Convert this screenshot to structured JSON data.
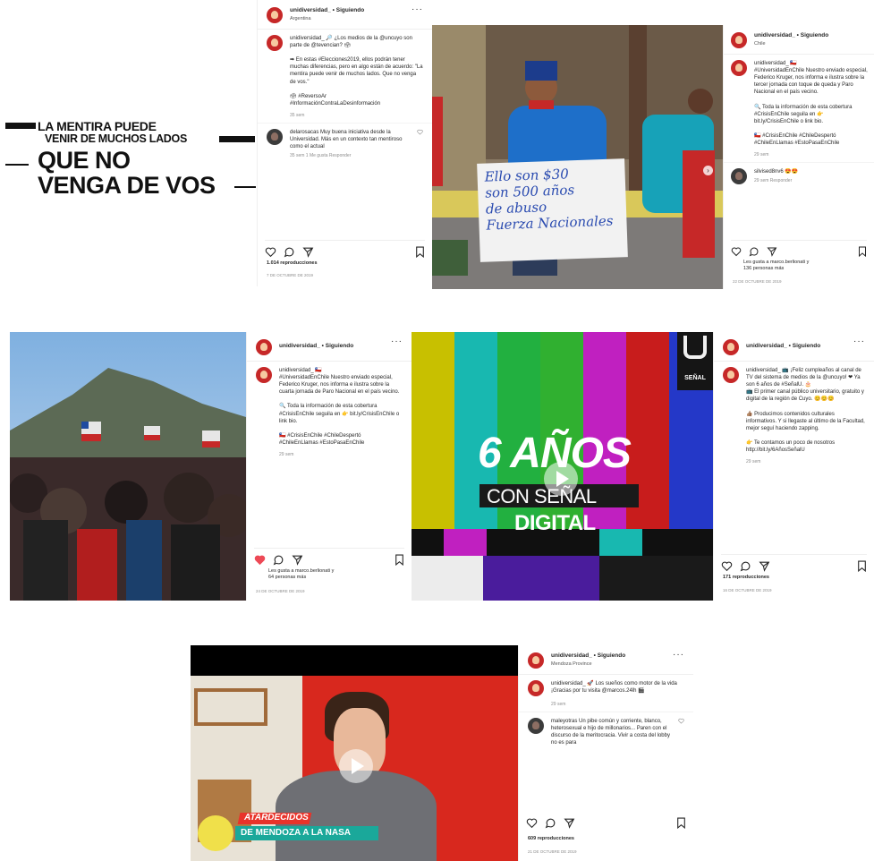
{
  "poster": {
    "line1": "LA MENTIRA PUEDE",
    "line2": "VENIR DE MUCHOS LADOS",
    "line3": "QUE NO",
    "line4": "VENGA DE VOS"
  },
  "post1": {
    "username": "unidiversidad_ • Siguiendo",
    "location": "Argentina",
    "caption": "unidiversidad_ 🔎 ¿Los medios de la @uncuyo son parte de @tevencian? 🗳\n\n➡ En estas #Elecciones2019, ellos podrán tener muchas diferencias, pero en algo están de acuerdo: \"La mentira puede venir de muchos lados. Que no venga de vos.\"\n\n🗳 #ReversoAr\n#InformaciónContraLaDesinformación",
    "time": "35 sem",
    "comment": "delarosacas Muy buena iniciativa desde la Universidad. Más en un contexto tan mentiroso como el actual",
    "comment_meta": "35 sem  1 Me gusta  Responder",
    "views": "1.014 reproducciones",
    "date": "7 DE OCTUBRE DE 2019"
  },
  "post2": {
    "username": "unidiversidad_ • Siguiendo",
    "location": "Chile",
    "caption": "unidiversidad_ 🇨🇱\n#UniversidadEnChile Nuestro enviado especial, Federico Kruger, nos informa e ilustra sobre la tercer jornada con toque de queda y Paro Nacional en el país vecino.\n\n🔍 Toda la información de esta cobertura #CrisisEnChile seguila en 👉 bit.ly/CrisisEnChile o link bio.\n\n🇨🇱 #CrisisEnChile #ChileDespertó\n#ChileEnLlamas #EstoPasaEnChile",
    "time": "29 sem",
    "comment": "silvised8nv6 😍😍",
    "comment_meta": "29 sem  Responder",
    "sign": "Ello son $30\nson 500 años\nde abuso\nFuerza Nacionales",
    "likes": "Les gusta a marco.berlionati y\n136 personas más",
    "date": "22 DE OCTUBRE DE 2019"
  },
  "post3": {
    "username": "unidiversidad_ • Siguiendo",
    "caption": "unidiversidad_ 🇨🇱\n#UniversidadEnChile Nuestro enviado especial, Federico Kruger, nos informa e ilustra sobre la cuarta jornada de Paro Nacional en el país vecino.\n\n🔍 Toda la información de esta cobertura #CrisisEnChile seguila en 👉 bit.ly/CrisisEnChile o link bio.\n\n🇨🇱 #CrisisEnChile #ChileDespertó\n#ChileEnLlamas #EstoPasaEnChile",
    "time": "29 sem",
    "likes": "Les gusta a marco.berlionati y\n64 personas más",
    "date": "24 DE OCTUBRE DE 2019"
  },
  "post4": {
    "username": "unidiversidad_ • Siguiendo",
    "overlay_big": "6 AÑOS",
    "overlay_mid": "CON SEÑAL",
    "overlay_small": "DIGITAL",
    "logo_text": "SEÑAL",
    "caption": "unidiversidad_ 📺 ¡Feliz cumpleaños al canal de TV del sistema de medios de la @uncuyo! ❤ Ya son 6 años de #SeñalU. 🎂\n📺 El primer canal público universitario, gratuito y digital de la región de Cuyo. 😊😊😊\n\n👍🏽 Producimos contenidos culturales informativos. Y si llegaste al último de la Facultad, mejor seguí haciendo zapping.\n\n👉 Te contamos un poco de nosotros http://bit.ly/6AñosSeñalU",
    "time": "29 sem",
    "views": "171 reproducciones",
    "date": "16 DE OCTUBRE DE 2019"
  },
  "post5": {
    "username": "unidiversidad_ • Siguiendo",
    "location": "Mendoza Province",
    "caption": "unidiversidad_ 🚀 Los sueños como motor de la vida ¡Gracias por tu visita @marcos.24lh 🎬",
    "time": "29 sem",
    "comment": "maleyotras Un pibe común y corriente, blanco, heterosexual e hijo de millonarios... Paren con el discurso de la meritocracia. Vivir a costa del lobby no es para",
    "banner_top": "ATARDECIDOS",
    "banner_bottom": "DE MENDOZA A LA NASA",
    "views": "609 reproducciones",
    "date": "21 DE OCTUBRE DE 2019"
  },
  "colors": {
    "like_red": "#ed4956",
    "link_blue": "#00376b"
  }
}
